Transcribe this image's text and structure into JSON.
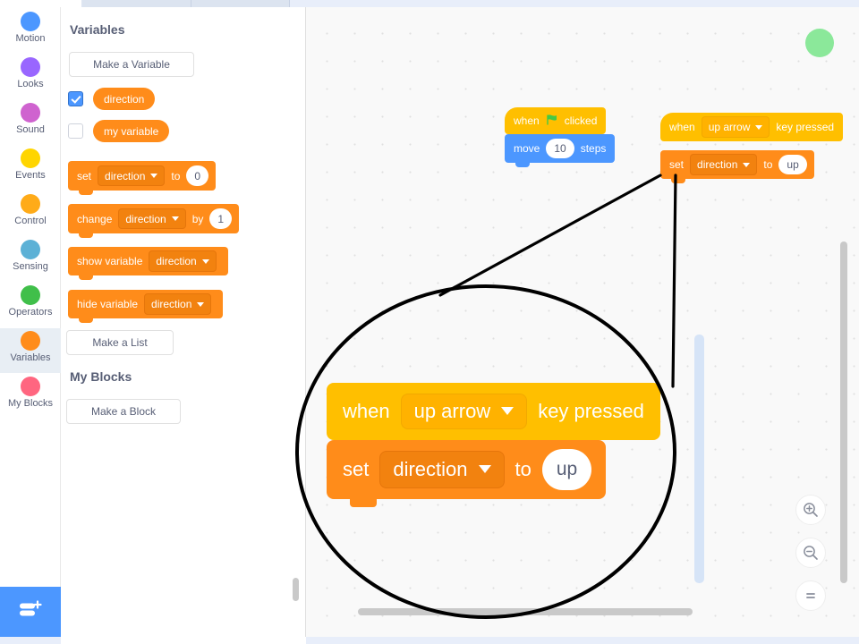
{
  "tabs": [
    {
      "name": "tab-active",
      "active": true
    },
    {
      "name": "tab-2",
      "active": false
    },
    {
      "name": "tab-3",
      "active": false
    }
  ],
  "categories": [
    {
      "label": "Motion",
      "color": "#4c97ff",
      "selected": false
    },
    {
      "label": "Looks",
      "color": "#9966ff",
      "selected": false
    },
    {
      "label": "Sound",
      "color": "#cf63cf",
      "selected": false
    },
    {
      "label": "Events",
      "color": "#ffd500",
      "selected": false
    },
    {
      "label": "Control",
      "color": "#ffab19",
      "selected": false
    },
    {
      "label": "Sensing",
      "color": "#5cb1d6",
      "selected": false
    },
    {
      "label": "Operators",
      "color": "#40bf4a",
      "selected": false
    },
    {
      "label": "Variables",
      "color": "#ff8c1a",
      "selected": true
    },
    {
      "label": "My Blocks",
      "color": "#ff6680",
      "selected": false
    }
  ],
  "extension_button": {
    "icon": "add-extension-icon"
  },
  "palette": {
    "title": "Variables",
    "make_variable_label": "Make a Variable",
    "variables": [
      {
        "name": "direction",
        "checked": true
      },
      {
        "name": "my variable",
        "checked": false
      }
    ],
    "blocks": [
      {
        "id": "set-var",
        "words": [
          "set"
        ],
        "dropdown": "direction",
        "mid": "to",
        "value": "0"
      },
      {
        "id": "change-var",
        "words": [
          "change"
        ],
        "dropdown": "direction",
        "mid": "by",
        "value": "1"
      },
      {
        "id": "show-var",
        "words": [
          "show variable"
        ],
        "dropdown": "direction",
        "mid": "",
        "value": ""
      },
      {
        "id": "hide-var",
        "words": [
          "hide variable"
        ],
        "dropdown": "direction",
        "mid": "",
        "value": ""
      }
    ],
    "make_list_label": "Make a List",
    "my_blocks_title": "My Blocks",
    "make_block_label": "Make a Block"
  },
  "workspace": {
    "script_flag": {
      "hat_pre": "when",
      "hat_icon": "green-flag-icon",
      "hat_post": "clicked",
      "body_pre": "move",
      "body_value": "10",
      "body_post": "steps"
    },
    "script_key": {
      "hat_pre": "when",
      "hat_dropdown": "up arrow",
      "hat_post": "key pressed",
      "body_pre": "set",
      "body_dropdown": "direction",
      "body_mid": "to",
      "body_value": "up"
    },
    "callout": {
      "hat_pre": "when",
      "hat_dropdown": "up arrow",
      "hat_post": "key pressed",
      "body_pre": "set",
      "body_dropdown": "direction",
      "body_mid": "to",
      "body_value": "up"
    },
    "marker_color": "#8be89a",
    "zoom_controls": [
      {
        "name": "zoom-in-icon"
      },
      {
        "name": "zoom-out-icon"
      },
      {
        "name": "zoom-reset-icon"
      }
    ]
  },
  "colors": {
    "variables": "#ff8c1a",
    "events": "#ffbf00",
    "motion": "#4c97ff",
    "accent": "#4c97ff",
    "annotation": "#000000"
  }
}
